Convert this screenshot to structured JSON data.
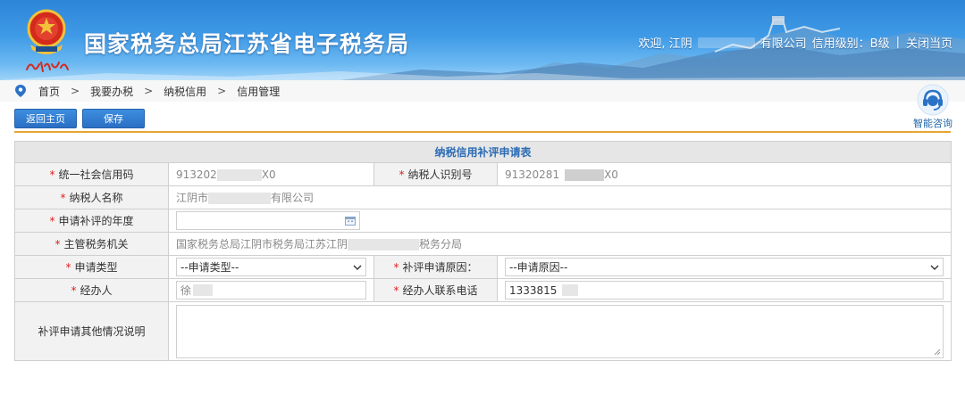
{
  "header": {
    "site_title": "国家税务总局江苏省电子税务局",
    "welcome_prefix": "欢迎, 江阴",
    "welcome_suffix": "有限公司",
    "credit_level": "信用级别：B级",
    "separator": "|",
    "close_label": "关闭当页"
  },
  "breadcrumb": {
    "items": [
      "首页",
      "我要办税",
      "纳税信用",
      "信用管理"
    ],
    "arrow": ">"
  },
  "assistant": {
    "label": "智能咨询"
  },
  "toolbar": {
    "back_label": "返回主页",
    "save_label": "保存"
  },
  "form": {
    "caption": "纳税信用补评申请表",
    "fields": {
      "credit_code": {
        "label": "统一社会信用码",
        "value_prefix": "913202",
        "value_suffix": "X0"
      },
      "taxpayer_id": {
        "label": "纳税人识别号",
        "value_prefix": "91320281",
        "value_suffix": "X0"
      },
      "taxpayer_name": {
        "label": "纳税人名称",
        "value_prefix": "江阴市",
        "value_suffix": "有限公司"
      },
      "year": {
        "label": "申请补评的年度",
        "value": ""
      },
      "tax_authority": {
        "label": "主管税务机关",
        "value_prefix": "国家税务总局江阴市税务局江苏江阴",
        "value_suffix": "税务分局"
      },
      "apply_type": {
        "label": "申请类型",
        "value": "--申请类型--"
      },
      "reason": {
        "label": "补评申请原因：",
        "value": "--申请原因--"
      },
      "handler": {
        "label": "经办人",
        "value": "徐"
      },
      "handler_phone": {
        "label": "经办人联系电话",
        "value": "1333815"
      },
      "other_notes": {
        "label": "补评申请其他情况说明",
        "value": ""
      }
    },
    "required_mark": "*"
  },
  "colors": {
    "banner_blue": "#3f9ae6",
    "button_blue": "#2a6fc4",
    "divider_orange": "#e7a531",
    "caption_text": "#2b6cb5",
    "required_red": "#e02020"
  }
}
